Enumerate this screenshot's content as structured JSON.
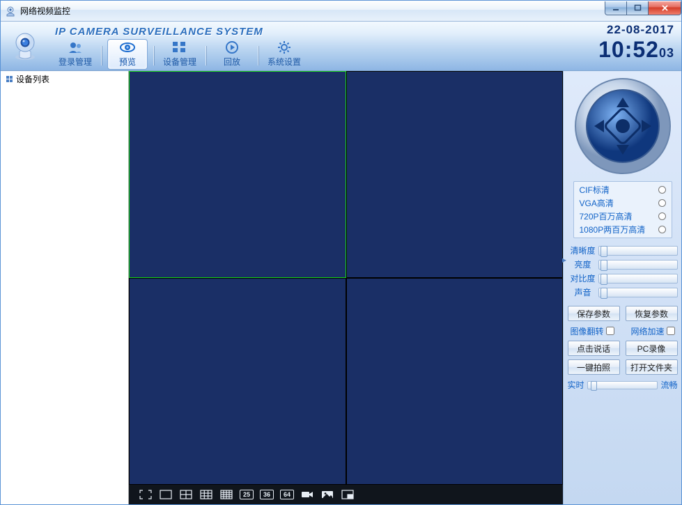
{
  "window": {
    "title": "网络视频监控"
  },
  "header": {
    "app_title": "IP CAMERA SURVEILLANCE SYSTEM",
    "date": "22-08-2017",
    "time": "10:52",
    "seconds": "03",
    "nav": {
      "login": "登录管理",
      "preview": "预览",
      "device": "设备管理",
      "replay": "回放",
      "system": "系统设置"
    }
  },
  "tree": {
    "root_label": "设备列表"
  },
  "video_toolbar": {
    "num25": "25",
    "num36": "36",
    "num64": "64"
  },
  "right": {
    "radios": {
      "cif": "CIF标清",
      "vga": "VGA高清",
      "p720": "720P百万高清",
      "p1080": "1080P两百万高清"
    },
    "sliders": {
      "clarity": "清晰度",
      "bright": "亮度",
      "contrast": "对比度",
      "sound": "声音"
    },
    "buttons": {
      "save": "保存参数",
      "restore": "恢复参数",
      "talk": "点击说话",
      "pcrec": "PC录像",
      "snap": "一键拍照",
      "open": "打开文件夹"
    },
    "checks": {
      "flip": "图像翻转",
      "accel": "网络加速"
    },
    "latency": {
      "left": "实时",
      "right": "流畅"
    }
  }
}
